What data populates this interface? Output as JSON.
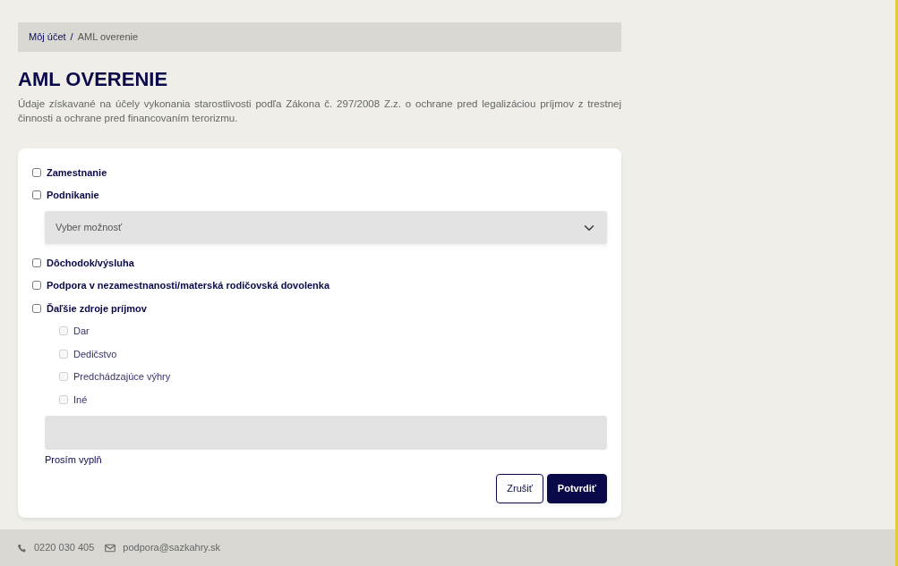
{
  "breadcrumb_separator": "/",
  "breadcrumb": [
    {
      "label": "Môj účet",
      "selected": false
    },
    {
      "label": "AML overenie",
      "selected": true
    }
  ],
  "title": "AML OVERENIE",
  "description": "Údaje získavané na účely vykonania starostlivosti podľa Zákona č. 297/2008 Z.z. o ochrane pred legalizáciou príjmov z trestnej činnosti a ochrane pred financovaním terorizmu.",
  "form": {
    "items": [
      {
        "kind": "checkbox",
        "label": "Zamestnanie",
        "checked": false,
        "disabled": false
      },
      {
        "kind": "checkbox",
        "label": "Podnikanie",
        "checked": false,
        "disabled": false
      },
      {
        "kind": "select",
        "placeholder": "Vyber možnosť"
      },
      {
        "kind": "checkbox",
        "label": "Dôchodok/výsluha",
        "checked": false,
        "disabled": false
      },
      {
        "kind": "checkbox",
        "label": "Podpora v nezamestnanosti/materská rodičovská dovolenka",
        "checked": false,
        "disabled": false
      },
      {
        "kind": "checkbox",
        "label": "Ďaľšie zdroje príjmov",
        "checked": false,
        "disabled": false
      },
      {
        "kind": "subcheckbox",
        "label": "Dar",
        "checked": false,
        "disabled": true
      },
      {
        "kind": "subcheckbox",
        "label": "Dedičstvo",
        "checked": false,
        "disabled": true
      },
      {
        "kind": "subcheckbox",
        "label": "Predchádzajúce výhry",
        "checked": false,
        "disabled": true
      },
      {
        "kind": "subcheckbox",
        "label": "Iné",
        "checked": false,
        "disabled": true
      },
      {
        "kind": "textarea"
      },
      {
        "kind": "help",
        "text": "Prosím vyplň"
      }
    ],
    "buttons": [
      {
        "label": "Zrušiť",
        "kind": "secondary"
      },
      {
        "label": "Potvrdiť",
        "kind": "primary"
      }
    ]
  },
  "footer": [
    {
      "kind": "phone",
      "text": "0220 030 405"
    },
    {
      "kind": "email",
      "text": "podpora@sazkahry.sk"
    }
  ]
}
